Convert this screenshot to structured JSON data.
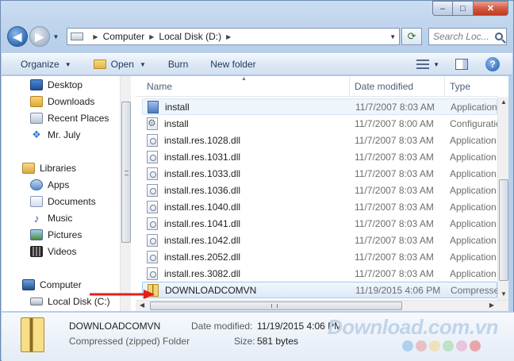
{
  "caption": {
    "minimize": "–",
    "maximize": "□",
    "close": "✕"
  },
  "nav": {
    "address_segments": [
      "Computer",
      "Local Disk (D:)"
    ],
    "search_placeholder": "Search Loc..."
  },
  "toolbar": {
    "organize": "Organize",
    "open": "Open",
    "burn": "Burn",
    "new_folder": "New folder"
  },
  "sidebar": {
    "favorites": [
      "Desktop",
      "Downloads",
      "Recent Places",
      "Mr. July"
    ],
    "libraries_label": "Libraries",
    "libraries": [
      "Apps",
      "Documents",
      "Music",
      "Pictures",
      "Videos"
    ],
    "computer_label": "Computer",
    "drives": [
      "Local Disk (C:)"
    ]
  },
  "columns": {
    "name": "Name",
    "date": "Date modified",
    "type": "Type"
  },
  "files": [
    {
      "name": "install",
      "date": "11/7/2007 8:03 AM",
      "type": "Application",
      "icon": "exe-icon"
    },
    {
      "name": "install",
      "date": "11/7/2007 8:00 AM",
      "type": "Configuration",
      "icon": "config-file-icon"
    },
    {
      "name": "install.res.1028.dll",
      "date": "11/7/2007 8:03 AM",
      "type": "Application",
      "icon": "dll-icon"
    },
    {
      "name": "install.res.1031.dll",
      "date": "11/7/2007 8:03 AM",
      "type": "Application",
      "icon": "dll-icon"
    },
    {
      "name": "install.res.1033.dll",
      "date": "11/7/2007 8:03 AM",
      "type": "Application",
      "icon": "dll-icon"
    },
    {
      "name": "install.res.1036.dll",
      "date": "11/7/2007 8:03 AM",
      "type": "Application",
      "icon": "dll-icon"
    },
    {
      "name": "install.res.1040.dll",
      "date": "11/7/2007 8:03 AM",
      "type": "Application",
      "icon": "dll-icon"
    },
    {
      "name": "install.res.1041.dll",
      "date": "11/7/2007 8:03 AM",
      "type": "Application",
      "icon": "dll-icon"
    },
    {
      "name": "install.res.1042.dll",
      "date": "11/7/2007 8:03 AM",
      "type": "Application",
      "icon": "dll-icon"
    },
    {
      "name": "install.res.2052.dll",
      "date": "11/7/2007 8:03 AM",
      "type": "Application",
      "icon": "dll-icon"
    },
    {
      "name": "install.res.3082.dll",
      "date": "11/7/2007 8:03 AM",
      "type": "Application",
      "icon": "dll-icon"
    },
    {
      "name": "DOWNLOADCOMVN",
      "date": "11/19/2015 4:06 PM",
      "type": "Compressed",
      "icon": "zip-folder-icon",
      "selected": true
    }
  ],
  "details": {
    "name": "DOWNLOADCOMVN",
    "kind": "Compressed (zipped) Folder",
    "date_label": "Date modified:",
    "date_value": "11/19/2015 4:06 PM",
    "size_label": "Size:",
    "size_value": "581 bytes"
  },
  "watermark": {
    "text": "Download.com.vn",
    "dot_colors": [
      "#7db7e8",
      "#e69a9a",
      "#f0d38a",
      "#9ad69a",
      "#e7a0c8",
      "#e86a6a"
    ]
  },
  "annotation": {
    "arrow_color": "#e0201b"
  }
}
